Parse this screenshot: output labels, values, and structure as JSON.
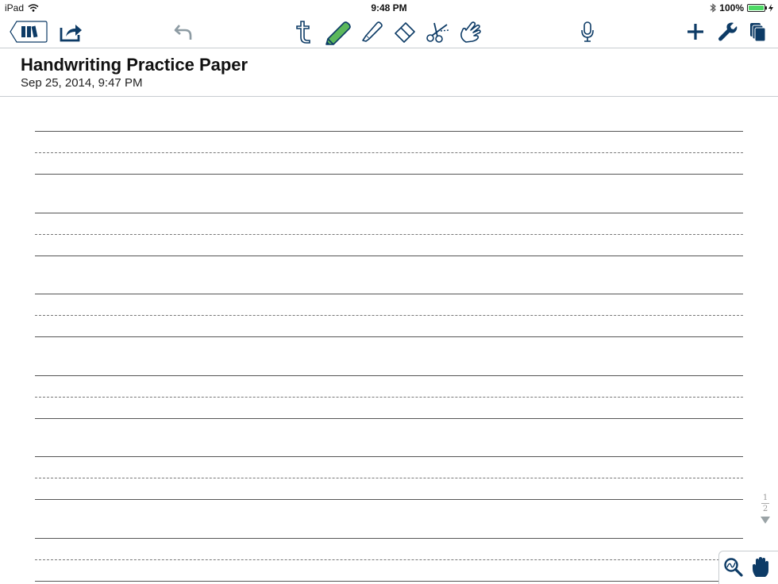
{
  "status_bar": {
    "device": "iPad",
    "time": "9:48 PM",
    "battery": "100%"
  },
  "icons": {
    "wifi": "wifi-icon",
    "bluetooth": "bluetooth-icon",
    "battery": "battery-icon",
    "library": "library-icon",
    "share": "share-icon",
    "undo": "undo-icon",
    "text": "text-tool-icon",
    "pen": "pen-tool-icon",
    "highlighter": "highlighter-tool-icon",
    "eraser": "eraser-tool-icon",
    "scissors": "scissors-tool-icon",
    "hand": "hand-tool-icon",
    "microphone": "microphone-icon",
    "add": "add-icon",
    "settings": "wrench-icon",
    "pages": "pages-icon",
    "zoom": "zoom-icon",
    "pan": "pan-hand-icon"
  },
  "colors": {
    "accent": "#0d3b66",
    "active_pen": "#5cb85c"
  },
  "document": {
    "title": "Handwriting Practice Paper",
    "date": "Sep 25, 2014, 9:47 PM"
  },
  "page_indicator": {
    "current": "1",
    "total": "2"
  }
}
